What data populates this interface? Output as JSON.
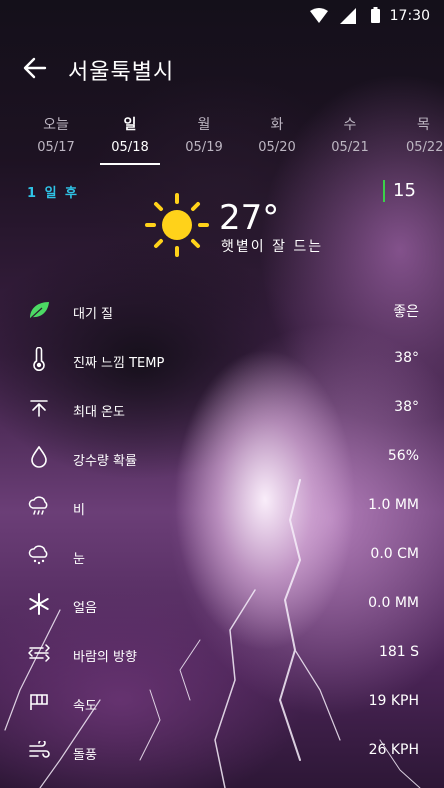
{
  "status_bar": {
    "time": "17:30"
  },
  "app_bar": {
    "title": "서울툭별시"
  },
  "days": [
    {
      "name": "오늘",
      "date": "05/17",
      "active": false
    },
    {
      "name": "일",
      "date": "05/18",
      "active": true
    },
    {
      "name": "월",
      "date": "05/19",
      "active": false
    },
    {
      "name": "화",
      "date": "05/20",
      "active": false
    },
    {
      "name": "수",
      "date": "05/21",
      "active": false
    },
    {
      "name": "목",
      "date": "05/22",
      "active": false
    }
  ],
  "summary": {
    "after_label": "1 일 후",
    "hour_value": "15",
    "temperature": "27°",
    "condition": "햇볕이 잘 드는"
  },
  "details": [
    {
      "icon": "leaf-icon",
      "label": "대기 질",
      "value": "좋은"
    },
    {
      "icon": "thermometer-icon",
      "label": "진짜 느낌 TEMP",
      "value": "38°"
    },
    {
      "icon": "max-temp-arrow-icon",
      "label": "최대 온도",
      "value": "38°"
    },
    {
      "icon": "droplet-icon",
      "label": "강수량 확률",
      "value": "56%"
    },
    {
      "icon": "rain-cloud-icon",
      "label": "비",
      "value": "1.0 MM"
    },
    {
      "icon": "snow-cloud-icon",
      "label": "눈",
      "value": "0.0 CM"
    },
    {
      "icon": "snowflake-icon",
      "label": "얼음",
      "value": "0.0 MM"
    },
    {
      "icon": "wind-direction-icon",
      "label": "바람의 방향",
      "value": "181 S"
    },
    {
      "icon": "wind-speed-icon",
      "label": "속도",
      "value": "19 KPH"
    },
    {
      "icon": "gust-icon",
      "label": "돌풍",
      "value": "26 KPH"
    }
  ],
  "colors": {
    "accent_cyan": "#2fc3e6",
    "accent_green": "#3bd14a",
    "sun_yellow": "#ffd21a",
    "leaf_green": "#4cd964"
  }
}
